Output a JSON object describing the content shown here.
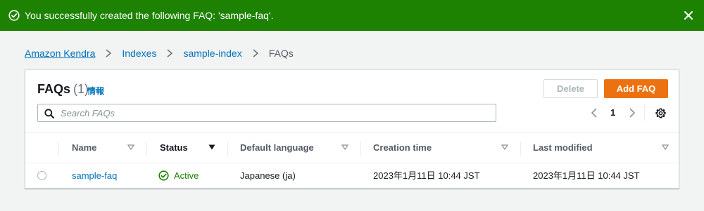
{
  "flash": {
    "message": "You successfully created the following FAQ: 'sample-faq'.",
    "color": "#1d8102"
  },
  "breadcrumb": {
    "items": [
      "Amazon Kendra",
      "Indexes",
      "sample-index"
    ],
    "current": "FAQs"
  },
  "header": {
    "title": "FAQs",
    "count": "(1)",
    "info_link": "情報"
  },
  "actions": {
    "delete_label": "Delete",
    "add_label": "Add FAQ",
    "accent_color": "#ec7211"
  },
  "search": {
    "placeholder": "Search FAQs",
    "value": ""
  },
  "pagination": {
    "current_page": "1"
  },
  "table": {
    "columns": [
      "Name",
      "Status",
      "Default language",
      "Creation time",
      "Last modified"
    ],
    "sorted_column": "Status",
    "rows": [
      {
        "name": "sample-faq",
        "status": "Active",
        "default_language": "Japanese (ja)",
        "creation_time": "2023年1月11日 10:44 JST",
        "last_modified": "2023年1月11日 10:44 JST",
        "selected": false
      }
    ]
  }
}
